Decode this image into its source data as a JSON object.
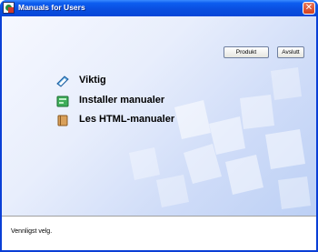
{
  "window": {
    "title": "Manuals for Users",
    "app_icon": "manuals-app-icon",
    "close_icon": "close-icon"
  },
  "toolbar": {
    "product_label": "Produkt",
    "exit_label": "Avslutt"
  },
  "menu": {
    "items": [
      {
        "label": "Viktig",
        "icon": "important-icon"
      },
      {
        "label": "Installer manualer",
        "icon": "install-icon"
      },
      {
        "label": "Les HTML-manualer",
        "icon": "html-manual-icon"
      }
    ]
  },
  "status": {
    "text": "Vennligst velg."
  },
  "colors": {
    "titlebar": "#0a4fe0",
    "close_button": "#d2401f",
    "client_background": "#cfdcf8",
    "status_bar": "#ffffff"
  }
}
